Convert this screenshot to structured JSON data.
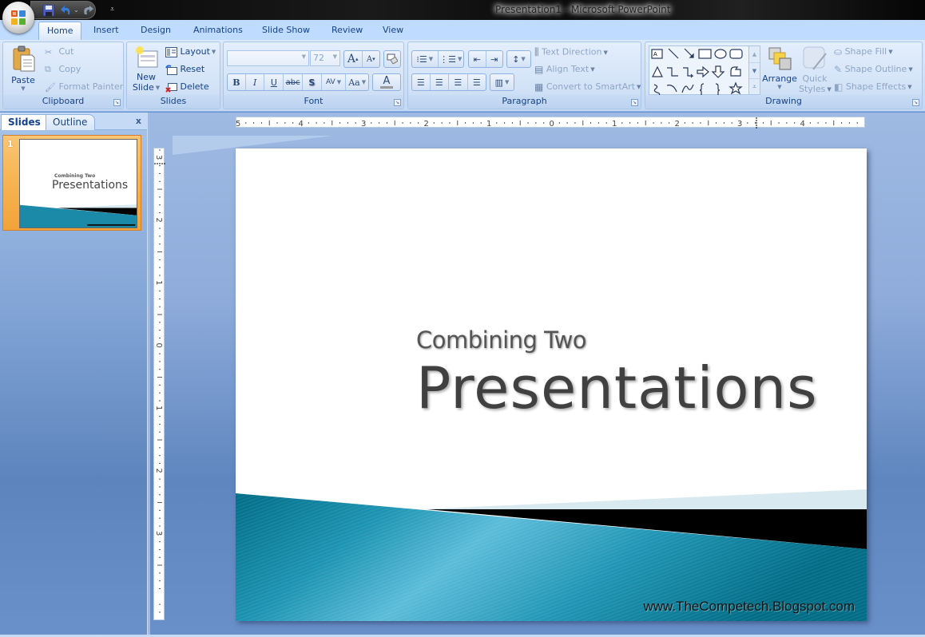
{
  "window": {
    "title": "Presentation1  -  Microsoft PowerPoint"
  },
  "quick_access": {
    "icons": [
      "save-icon",
      "undo-icon",
      "redo-icon",
      "customize-icon"
    ]
  },
  "tabs": [
    {
      "label": "Home",
      "active": true
    },
    {
      "label": "Insert"
    },
    {
      "label": "Design"
    },
    {
      "label": "Animations"
    },
    {
      "label": "Slide Show"
    },
    {
      "label": "Review"
    },
    {
      "label": "View"
    }
  ],
  "ribbon": {
    "clipboard": {
      "label": "Clipboard",
      "paste": "Paste",
      "cut": "Cut",
      "copy": "Copy",
      "format_painter": "Format Painter"
    },
    "slides": {
      "label": "Slides",
      "new_slide_line1": "New",
      "new_slide_line2": "Slide",
      "layout": "Layout",
      "reset": "Reset",
      "delete": "Delete"
    },
    "font": {
      "label": "Font",
      "font_name": "",
      "font_size": "72",
      "bold": "B",
      "italic": "I",
      "underline": "U",
      "strikethrough": "abc",
      "shadow": "S",
      "spacing": "AV",
      "change_case": "Aa",
      "grow": "A",
      "shrink": "A",
      "color": "A"
    },
    "paragraph": {
      "label": "Paragraph",
      "text_direction": "Text Direction",
      "align_text": "Align Text",
      "convert_smartart": "Convert to SmartArt"
    },
    "drawing": {
      "label": "Drawing",
      "arrange": "Arrange",
      "quick_styles_line1": "Quick",
      "quick_styles_line2": "Styles",
      "shape_fill": "Shape Fill",
      "shape_outline": "Shape Outline",
      "shape_effects": "Shape Effects"
    }
  },
  "left_panel": {
    "tabs": [
      "Slides",
      "Outline"
    ],
    "close": "x",
    "thumbnails": [
      {
        "number": "1",
        "subtitle": "Combining Two",
        "title": "Presentations"
      }
    ]
  },
  "rulers": {
    "horizontal_labels": [
      "5",
      "4",
      "3",
      "2",
      "1",
      "0",
      "1",
      "2",
      "3",
      "4"
    ],
    "vertical_labels": [
      "3",
      "2",
      "1",
      "0",
      "1",
      "2",
      "3"
    ]
  },
  "slide": {
    "subtitle": "Combining Two",
    "title": "Presentations",
    "footer": "www.TheCompetech.Blogspot.com",
    "colors": {
      "teal": "#1a8aa8",
      "teal_dark": "#006c85",
      "teal_light": "#5bbcd8",
      "black_band": "#000000",
      "pale_band": "#d8e9f0"
    }
  }
}
